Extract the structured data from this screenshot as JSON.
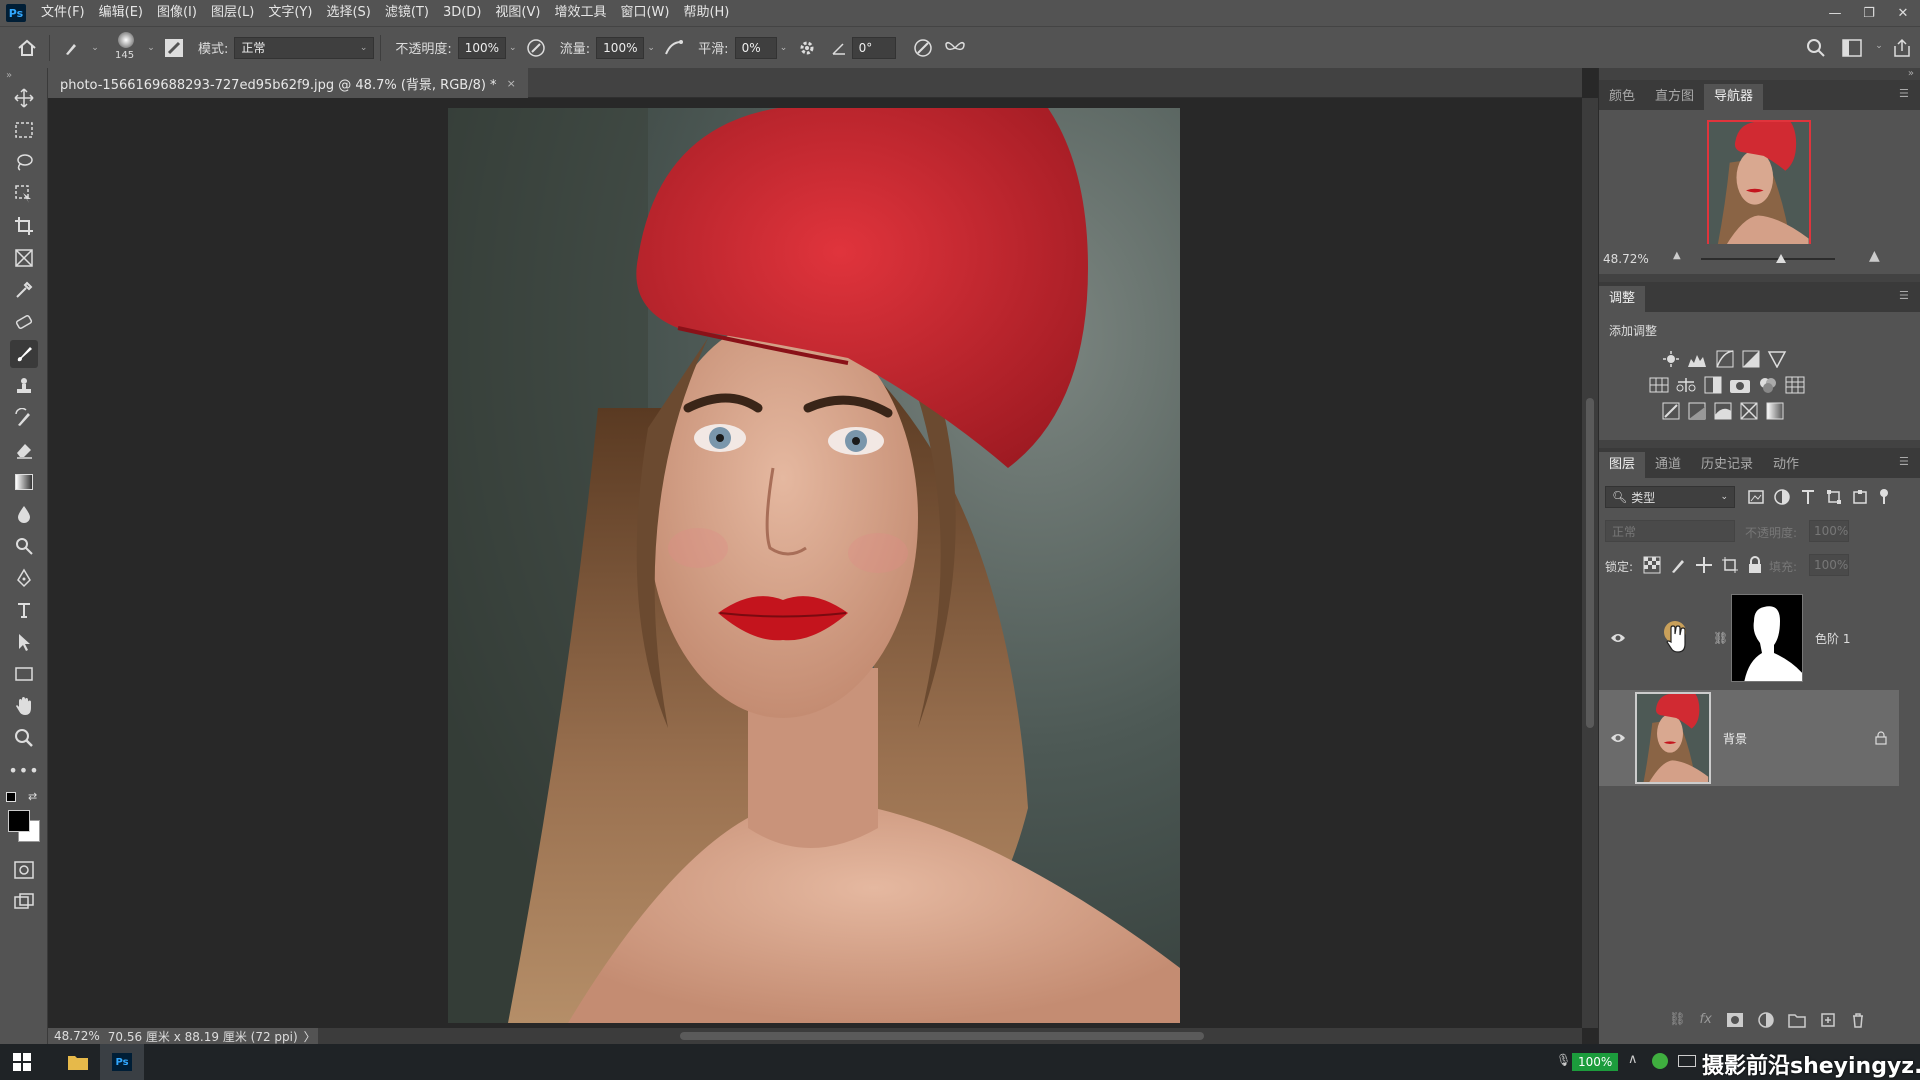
{
  "menubar": {
    "items": [
      "文件(F)",
      "编辑(E)",
      "图像(I)",
      "图层(L)",
      "文字(Y)",
      "选择(S)",
      "滤镜(T)",
      "3D(D)",
      "视图(V)",
      "增效工具",
      "窗口(W)",
      "帮助(H)"
    ],
    "logo": "Ps"
  },
  "options": {
    "brush_size": "145",
    "mode_label": "模式:",
    "mode_value": "正常",
    "opacity_label": "不透明度:",
    "opacity_value": "100%",
    "flow_label": "流量:",
    "flow_value": "100%",
    "smooth_label": "平滑:",
    "smooth_value": "0%",
    "angle_value": "0°"
  },
  "document": {
    "tab_title": "photo-1566169688293-727ed95b62f9.jpg @ 48.7% (背景, RGB/8) *",
    "close": "×"
  },
  "status": {
    "zoom": "48.72%",
    "dimensions": "70.56 厘米 x 88.19 厘米 (72 ppi)",
    "arrow": "〉"
  },
  "navigator": {
    "tabs": [
      "颜色",
      "直方图",
      "导航器"
    ],
    "zoom": "48.72%",
    "zoom_fraction": 0.6
  },
  "adjustments": {
    "tab": "调整",
    "add_label": "添加调整"
  },
  "layers": {
    "tabs": [
      "图层",
      "通道",
      "历史记录",
      "动作"
    ],
    "filter_label": "类型",
    "blend_mode": "正常",
    "opacity_label": "不透明度:",
    "opacity_value": "100%",
    "lock_label": "锁定:",
    "fill_label": "填充:",
    "fill_value": "100%",
    "items": [
      {
        "name": "色阶 1"
      },
      {
        "name": "背景"
      }
    ]
  },
  "taskbar": {
    "battery": "100%",
    "watermark": "摄影前沿sheyingyz.com"
  }
}
